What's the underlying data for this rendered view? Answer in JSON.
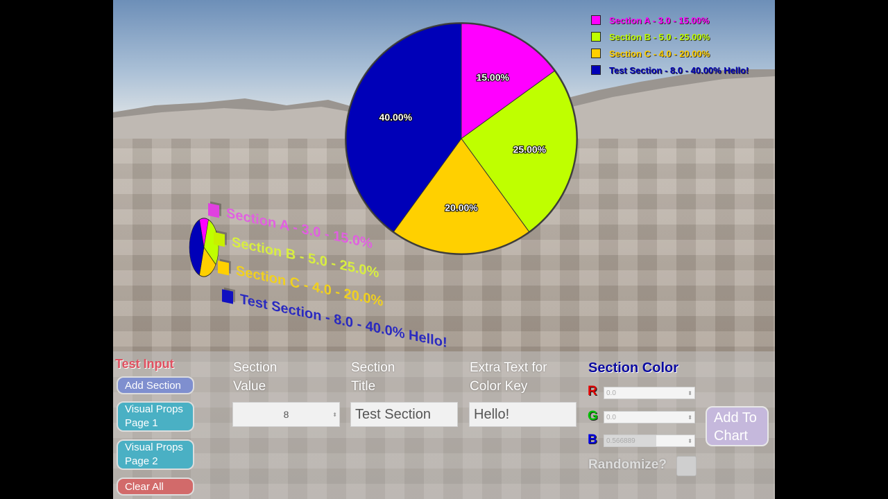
{
  "colors": {
    "section_a": "#ff00ff",
    "section_b": "#bfff00",
    "section_c": "#ffd000",
    "test_section": "#0000b8"
  },
  "chart_data": {
    "type": "pie",
    "slices": [
      {
        "label": "Section A - 3.0 - 15.00%",
        "value": 3.0,
        "percent": "15.00%",
        "color": "#ff00ff"
      },
      {
        "label": "Section B - 5.0 - 25.00%",
        "value": 5.0,
        "percent": "25.00%",
        "color": "#bfff00"
      },
      {
        "label": "Section C - 4.0 - 20.00%",
        "value": 4.0,
        "percent": "20.00%",
        "color": "#ffd000"
      },
      {
        "label": "Test Section - 8.0 - 40.00%  Hello!",
        "value": 8.0,
        "percent": "40.00%",
        "color": "#0000b8"
      }
    ],
    "legend_position": "top-right"
  },
  "world_chart": {
    "labels": [
      "Section A - 3.0 - 15.0%",
      "Section B - 5.0 - 25.0%",
      "Section C - 4.0 - 20.0%",
      "Test Section - 8.0 - 40.0% Hello!"
    ]
  },
  "panel": {
    "title": "Test Input",
    "buttons": {
      "add_section": "Add Section",
      "visual_props_1": "Visual Props Page 1",
      "visual_props_2": "Visual Props Page 2",
      "clear_all": "Clear All",
      "add_to_chart": "Add To Chart"
    },
    "section_value": {
      "label": "Section Value",
      "value": "8"
    },
    "section_title": {
      "label": "Section Title",
      "value": "Test Section"
    },
    "extra_text": {
      "label": "Extra Text for Color Key",
      "value": "Hello!"
    },
    "section_color": {
      "title": "Section Color",
      "r_label": "R",
      "r_value": "0.0",
      "g_label": "G",
      "g_value": "0.0",
      "b_label": "B",
      "b_value": "0.566889"
    },
    "randomize_label": "Randomize?"
  }
}
